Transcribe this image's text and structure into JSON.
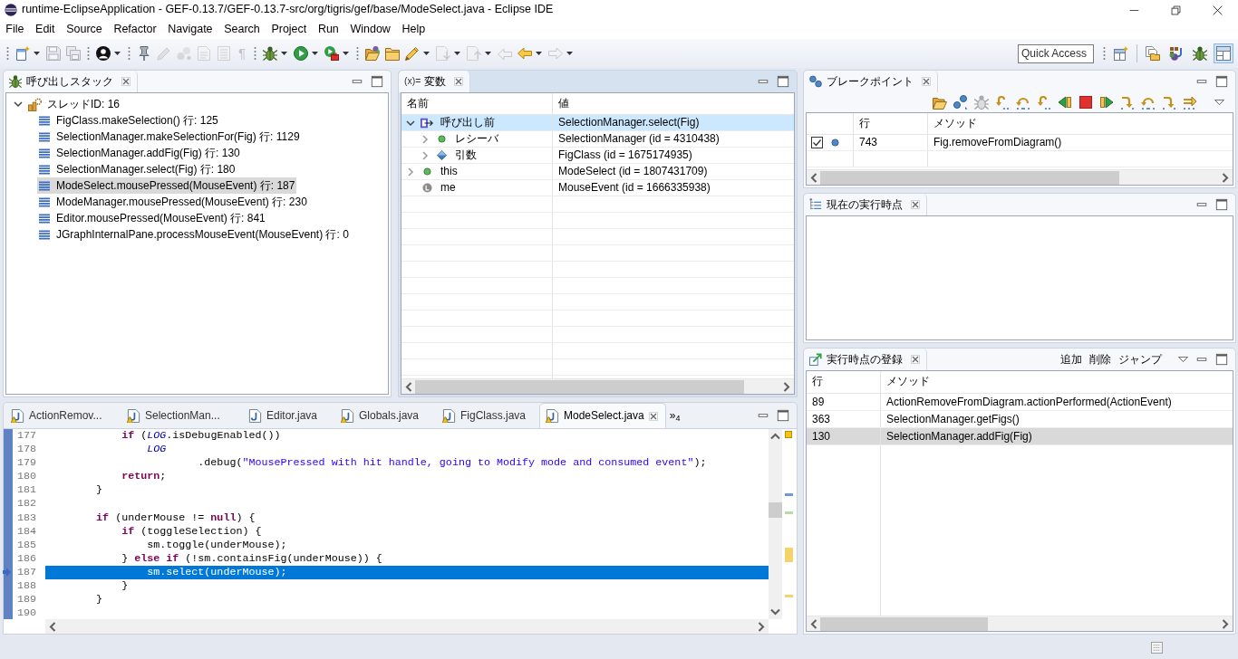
{
  "window": {
    "title": "runtime-EclipseApplication - GEF-0.13.7/GEF-0.13.7-src/org/tigris/gef/base/ModeSelect.java - Eclipse IDE"
  },
  "menu": [
    "File",
    "Edit",
    "Source",
    "Refactor",
    "Navigate",
    "Search",
    "Project",
    "Run",
    "Window",
    "Help"
  ],
  "toolbar": [
    {
      "kind": "grip"
    },
    {
      "kind": "new",
      "dropdown": true,
      "disabled": false
    },
    {
      "kind": "save",
      "disabled": true
    },
    {
      "kind": "save-all",
      "disabled": true
    },
    {
      "kind": "grip"
    },
    {
      "kind": "user",
      "dropdown": true,
      "disabled": false
    },
    {
      "kind": "grip"
    },
    {
      "kind": "pin",
      "disabled": false
    },
    {
      "kind": "pen",
      "disabled": true
    },
    {
      "kind": "dots",
      "disabled": true
    },
    {
      "kind": "doc",
      "disabled": true
    },
    {
      "kind": "list",
      "disabled": true
    },
    {
      "kind": "glyph",
      "label": "¶",
      "disabled": true
    },
    {
      "kind": "grip"
    },
    {
      "kind": "bug",
      "dropdown": true,
      "disabled": false
    },
    {
      "kind": "run",
      "dropdown": true,
      "disabled": false
    },
    {
      "kind": "run-tool",
      "dropdown": true,
      "disabled": false
    },
    {
      "kind": "grip"
    },
    {
      "kind": "folder-open",
      "disabled": false
    },
    {
      "kind": "folder",
      "disabled": false
    },
    {
      "kind": "marker",
      "dropdown": true,
      "disabled": false
    },
    {
      "kind": "doc-down",
      "dropdown": true,
      "disabled": true
    },
    {
      "kind": "doc-up",
      "dropdown": true,
      "disabled": true
    },
    {
      "kind": "edit-back",
      "disabled": true
    },
    {
      "kind": "back",
      "dropdown": true,
      "disabled": false
    },
    {
      "kind": "forward",
      "dropdown": true,
      "disabled": true
    }
  ],
  "quick_access": {
    "placeholder": "Quick Access"
  },
  "perspectives": [
    {
      "kind": "open-perspective",
      "selected": false
    },
    {
      "kind": "separator"
    },
    {
      "kind": "resource",
      "selected": false
    },
    {
      "kind": "java",
      "selected": false
    },
    {
      "kind": "debug",
      "selected": false
    },
    {
      "kind": "layout",
      "selected": true
    }
  ],
  "call_stack": {
    "title": "呼び出しスタック",
    "active": false,
    "threads": [
      {
        "label": "スレッドID: 16",
        "expanded": true,
        "selected": false,
        "children": [
          {
            "label": "FigClass.makeSelection() 行: 125",
            "selected": false
          },
          {
            "label": "SelectionManager.makeSelectionFor(Fig) 行: 1129",
            "selected": false
          },
          {
            "label": "SelectionManager.addFig(Fig) 行: 130",
            "selected": false
          },
          {
            "label": "SelectionManager.select(Fig) 行: 180",
            "selected": false
          },
          {
            "label": "ModeSelect.mousePressed(MouseEvent) 行: 187",
            "selected": true
          },
          {
            "label": "ModeManager.mousePressed(MouseEvent) 行: 230",
            "selected": false
          },
          {
            "label": "Editor.mousePressed(MouseEvent) 行: 841",
            "selected": false
          },
          {
            "label": "JGraphInternalPane.processMouseEvent(MouseEvent) 行: 0",
            "selected": false
          }
        ]
      }
    ]
  },
  "variables": {
    "icon_text": "(x)=",
    "title": "変数",
    "active": true,
    "columns": [
      "名前",
      "値"
    ],
    "rows": [
      {
        "kind": "frame",
        "name": "呼び出し前",
        "value": "SelectionManager.select(Fig)",
        "expanded": true,
        "selected": true,
        "children": [
          {
            "kind": "field",
            "name": "レシーバ",
            "value": "SelectionManager (id = 4310438)",
            "expanded": false,
            "selected": false
          },
          {
            "kind": "args",
            "name": "引数",
            "value": "FigClass (id = 1675174935)",
            "expanded": false,
            "selected": false
          }
        ]
      },
      {
        "kind": "field",
        "name": "this",
        "value": "ModeSelect (id = 1807431709)",
        "expanded": false,
        "selected": false
      },
      {
        "kind": "local",
        "name": "me",
        "value": "MouseEvent (id = 1666335938)",
        "selected": false
      }
    ]
  },
  "breakpoints": {
    "title": "ブレークポイント",
    "active": false,
    "columns": [
      "行",
      "メソッド"
    ],
    "rows": [
      {
        "checked": true,
        "selected": false,
        "line": "743",
        "method": "Fig.removeFromDiagram()"
      }
    ]
  },
  "execution_point": {
    "title": "現在の実行時点",
    "active": false
  },
  "registered_points": {
    "title": "実行時点の登録",
    "active": false,
    "actions": [
      "追加",
      "削除",
      "ジャンプ"
    ],
    "columns": [
      "行",
      "メソッド"
    ],
    "rows": [
      {
        "line": "89",
        "method": "ActionRemoveFromDiagram.actionPerformed(ActionEvent)",
        "selected": false
      },
      {
        "line": "363",
        "method": "SelectionManager.getFigs()",
        "selected": false
      },
      {
        "line": "130",
        "method": "SelectionManager.addFig(Fig)",
        "selected": true
      }
    ]
  },
  "editor": {
    "active": false,
    "tabs": [
      {
        "label": "ActionRemov...",
        "selected": false,
        "warning": true
      },
      {
        "label": "SelectionMan...",
        "selected": false,
        "warning": true
      },
      {
        "label": "Editor.java",
        "selected": false,
        "warning": false
      },
      {
        "label": "Globals.java",
        "selected": false,
        "warning": true
      },
      {
        "label": "FigClass.java",
        "selected": false,
        "warning": true
      },
      {
        "label": "ModeSelect.java",
        "selected": true,
        "warning": true
      }
    ],
    "more_tabs": "»$_{4}$",
    "lines": [
      {
        "number": "177",
        "current": false,
        "code": [
          {
            "text": "            if",
            "kind": "keyword"
          },
          {
            "text": " (",
            "kind": "plain"
          },
          {
            "text": "LOG",
            "kind": "field"
          },
          {
            "text": ".isDebugEnabled())",
            "kind": "plain"
          }
        ]
      },
      {
        "number": "178",
        "current": false,
        "code": [
          {
            "text": "                LOG",
            "kind": "field"
          }
        ]
      },
      {
        "number": "179",
        "current": false,
        "code": [
          {
            "text": "                        .debug(",
            "kind": "plain"
          },
          {
            "text": "\"MousePressed with hit handle, going to Modify mode and consumed event\"",
            "kind": "string"
          },
          {
            "text": ");",
            "kind": "plain"
          }
        ]
      },
      {
        "number": "180",
        "current": false,
        "code": [
          {
            "text": "            return",
            "kind": "keyword"
          },
          {
            "text": ";",
            "kind": "plain"
          }
        ]
      },
      {
        "number": "181",
        "current": false,
        "code": [
          {
            "text": "        }",
            "kind": "plain"
          }
        ]
      },
      {
        "number": "182",
        "current": false
      },
      {
        "number": "183",
        "current": false,
        "code": [
          {
            "text": "        if",
            "kind": "keyword"
          },
          {
            "text": " (underMouse != ",
            "kind": "plain"
          },
          {
            "text": "null",
            "kind": "keyword"
          },
          {
            "text": ") {",
            "kind": "plain"
          }
        ]
      },
      {
        "number": "184",
        "current": false,
        "code": [
          {
            "text": "            if",
            "kind": "keyword"
          },
          {
            "text": " (toggleSelection) {",
            "kind": "plain"
          }
        ]
      },
      {
        "number": "185",
        "current": false,
        "code": [
          {
            "text": "                sm.toggle(underMouse);",
            "kind": "plain"
          }
        ]
      },
      {
        "number": "186",
        "current": false,
        "code": [
          {
            "text": "            } ",
            "kind": "plain"
          },
          {
            "text": "else if",
            "kind": "keyword"
          },
          {
            "text": " (!sm.containsFig(underMouse)) {",
            "kind": "plain"
          }
        ]
      },
      {
        "number": "187",
        "current": true,
        "code": [
          {
            "text": "                sm.select(underMouse);",
            "kind": "plain"
          }
        ]
      },
      {
        "number": "188",
        "current": false,
        "code": [
          {
            "text": "            }",
            "kind": "plain"
          }
        ]
      },
      {
        "number": "189",
        "current": false,
        "code": [
          {
            "text": "        }",
            "kind": "plain"
          }
        ]
      },
      {
        "number": "190",
        "current": false
      }
    ]
  }
}
